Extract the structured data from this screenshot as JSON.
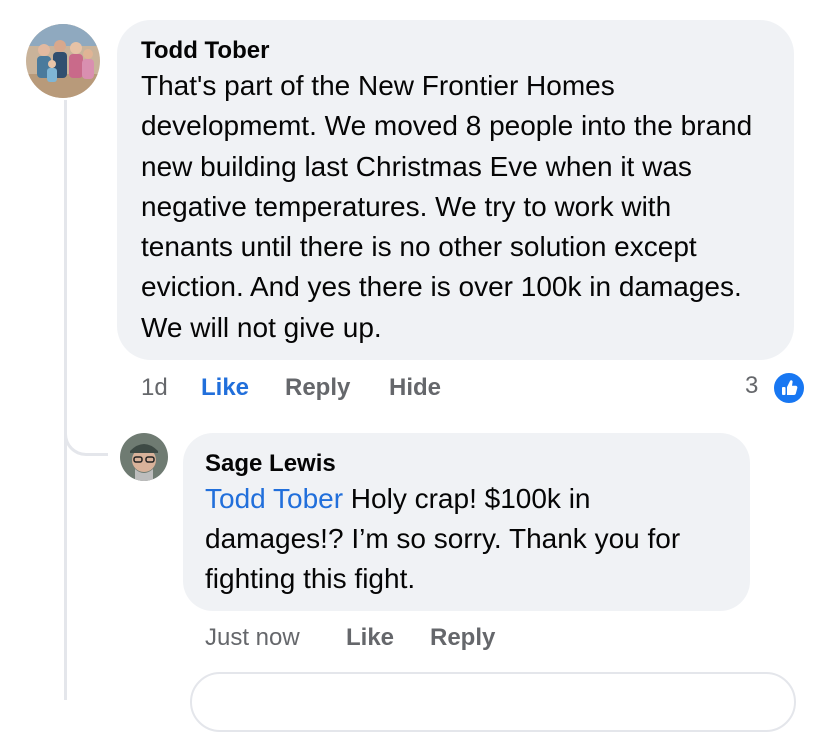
{
  "comment": {
    "author": "Todd Tober",
    "text": "That's part of the New Frontier Homes developmemt.  We moved 8 people into the brand new building last Christmas Eve when it was negative temperatures.  We try to work with tenants until there is no other solution except eviction.  And yes there is over 100k in damages.  We will not give up.",
    "timestamp": "1d",
    "like_label": "Like",
    "reply_label": "Reply",
    "hide_label": "Hide",
    "reaction_count": "3",
    "reaction_icon": "like-icon"
  },
  "reply": {
    "author": "Sage Lewis",
    "mention": "Todd Tober",
    "text": " Holy crap! $100k in damages!? I’m so sorry. Thank you for fighting this fight.",
    "timestamp": "Just now",
    "like_label": "Like",
    "reply_label": "Reply"
  },
  "colors": {
    "bubble": "#f0f2f5",
    "link": "#216fdb",
    "meta": "#65676b",
    "reaction": "#1877f2"
  }
}
